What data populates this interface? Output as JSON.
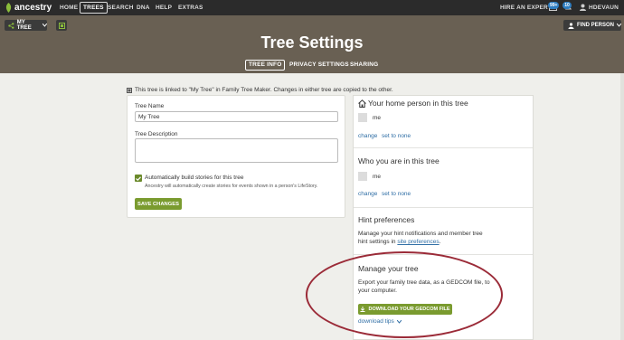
{
  "nav": {
    "logo": "ancestry",
    "links": [
      "HOME",
      "TREES",
      "SEARCH",
      "DNA",
      "HELP",
      "EXTRAS"
    ],
    "hire": "HIRE AN EXPERT",
    "badge1": "99+",
    "badge2": "10",
    "user": "HDEVAUN"
  },
  "toolbar": {
    "my_tree": "MY TREE",
    "find_person": "FIND PERSON"
  },
  "page": {
    "title": "Tree Settings",
    "tabs": [
      "TREE INFO",
      "PRIVACY SETTINGS",
      "SHARING"
    ],
    "linked_note": "This tree is linked to \"My Tree\" in Family Tree Maker. Changes in either tree are copied to the other."
  },
  "form": {
    "tree_name_label": "Tree Name",
    "tree_name_value": "My Tree",
    "desc_label": "Tree Description",
    "desc_value": "",
    "auto_label": "Automatically build stories for this tree",
    "auto_sub": "Ancestry will automatically create stories for events shown in a person's LifeStory.",
    "save": "SAVE CHANGES"
  },
  "right": {
    "home_title": "Your home person in this tree",
    "home_name": "me",
    "change": "change",
    "set_none": "set to none",
    "who_title": "Who you are in this tree",
    "who_name": "me",
    "hint_title": "Hint preferences",
    "hint_text_1": "Manage your hint notifications and member tree",
    "hint_text_2": "hint settings in ",
    "hint_link": "site preferences",
    "manage_title": "Manage your tree",
    "manage_text_1": "Export your family tree data, as a GEDCOM file, to",
    "manage_text_2": "your computer.",
    "download": "DOWNLOAD YOUR GEDCOM FILE",
    "tips": "download tips"
  },
  "colors": {
    "band": "#696053",
    "nav": "#2b2b2b",
    "green": "#7a9b2f",
    "link": "#2f6ea5",
    "annotation": "#9b2b38"
  },
  "icons": [
    "leaf-logo-icon",
    "tree-icon",
    "share-icon",
    "chevron-down-icon",
    "person-find-icon",
    "envelope-icon",
    "bell-icon",
    "user-icon",
    "house-icon",
    "check-icon",
    "download-icon"
  ]
}
